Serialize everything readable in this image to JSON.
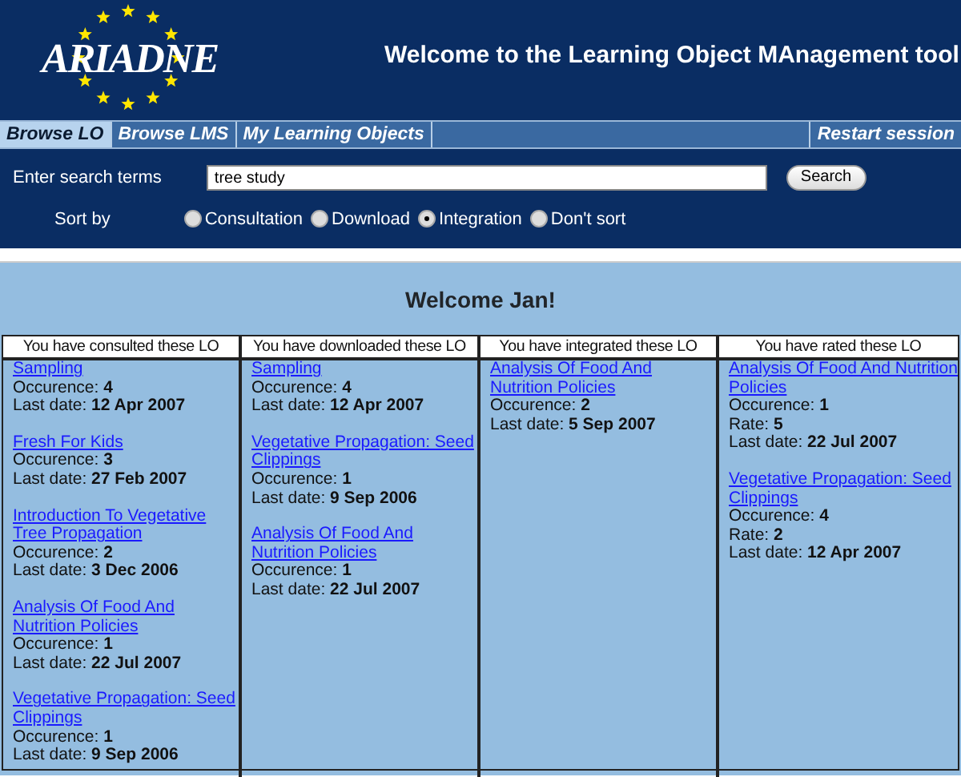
{
  "header": {
    "logo": "ARIADNE",
    "title": "Welcome to the Learning Object MAnagement tool"
  },
  "tabs": [
    {
      "label": "Browse LO",
      "selected": true
    },
    {
      "label": "Browse LMS",
      "selected": false
    },
    {
      "label": "My Learning Objects",
      "selected": false
    }
  ],
  "restart": "Restart session",
  "search": {
    "label": "Enter search terms",
    "value": "tree study",
    "button": "Search"
  },
  "sort": {
    "label": "Sort by",
    "options": [
      {
        "label": "Consultation",
        "selected": false
      },
      {
        "label": "Download",
        "selected": false
      },
      {
        "label": "Integration",
        "selected": true
      },
      {
        "label": "Don't sort",
        "selected": false
      }
    ]
  },
  "welcome": "Welcome Jan!",
  "columns": [
    {
      "heading": "You have consulted these LO",
      "items": [
        {
          "title": "Sampling",
          "lines": [
            "Occurence: **4**",
            "Last date: **12 Apr 2007**"
          ]
        },
        {
          "title": "Fresh For Kids",
          "lines": [
            "Occurence: **3**",
            "Last date: **27 Feb 2007**"
          ]
        },
        {
          "title": "Introduction To Vegetative Tree Propagation",
          "lines": [
            "Occurence: **2**",
            "Last date: **3 Dec 2006**"
          ]
        },
        {
          "title": "Analysis Of Food And Nutrition Policies",
          "lines": [
            "Occurence: **1**",
            "Last date: **22 Jul 2007**"
          ]
        },
        {
          "title": "Vegetative Propagation: Seed Clippings",
          "lines": [
            "Occurence: **1**",
            "Last date: **9 Sep 2006**"
          ]
        }
      ]
    },
    {
      "heading": "You have downloaded these LO",
      "items": [
        {
          "title": "Sampling",
          "lines": [
            "Occurence: **4**",
            "Last date: **12 Apr 2007**"
          ]
        },
        {
          "title": "Vegetative Propagation: Seed Clippings",
          "lines": [
            "Occurence: **1**",
            "Last date: **9 Sep 2006**"
          ]
        },
        {
          "title": "Analysis Of Food And Nutrition Policies",
          "lines": [
            "Occurence: **1**",
            "Last date: **22 Jul 2007**"
          ]
        }
      ]
    },
    {
      "heading": "You have integrated these LO",
      "items": [
        {
          "title": "Analysis Of Food And Nutrition Policies",
          "lines": [
            "Occurence: **2**",
            "Last date: **5 Sep 2007**"
          ]
        }
      ]
    },
    {
      "heading": "You have rated these LO",
      "items": [
        {
          "title": "Analysis Of Food And Nutrition Policies",
          "lines": [
            "Occurence: **1**",
            "Rate: **5**",
            "Last date: **22 Jul 2007**"
          ]
        },
        {
          "title": "Vegetative Propagation: Seed Clippings",
          "lines": [
            "Occurence: **4**",
            "Rate: **2**",
            "Last date: **12 Apr 2007**"
          ]
        }
      ]
    }
  ]
}
